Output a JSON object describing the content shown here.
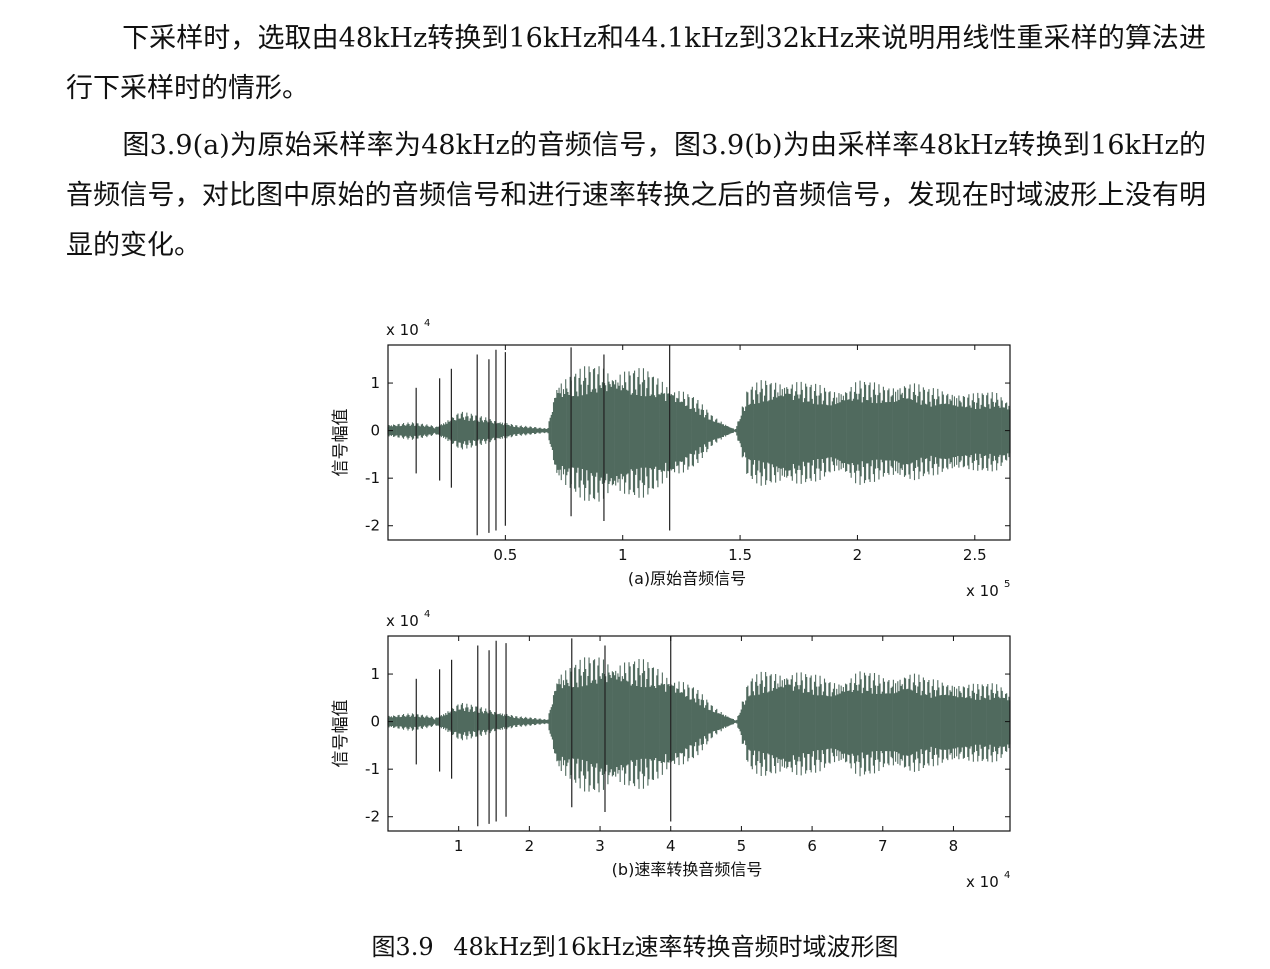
{
  "paragraphs": [
    "下采样时，选取由48kHz转换到16kHz和44.1kHz到32kHz来说明用线性重采样的算法进行下采样时的情形。",
    "图3.9(a)为原始采样率为48kHz的音频信号，图3.9(b)为由采样率48kHz转换到16kHz的音频信号，对比图中原始的音频信号和进行速率转换之后的音频信号，发现在时域波形上没有明显的变化。"
  ],
  "chart_data": [
    {
      "type": "line",
      "subtitle": "(a)原始音频信号",
      "ylabel": "信号幅值",
      "y_multiplier": "x 10",
      "y_exponent": "4",
      "x_multiplier": "x 10",
      "x_exponent": "5",
      "xlim": [
        0.0,
        2.65
      ],
      "ylim": [
        -2.3,
        1.8
      ],
      "xticks": [
        0.5,
        1,
        1.5,
        2,
        2.5
      ],
      "xtick_labels": [
        "0.5",
        "1",
        "1.5",
        "2",
        "2.5"
      ],
      "yticks": [
        1,
        0,
        -1,
        -2
      ],
      "ytick_labels": [
        "1",
        "0",
        "-1",
        "-2"
      ],
      "series_color": "#3d5a4c",
      "envelope": {
        "x": [
          0.0,
          0.1,
          0.19,
          0.2,
          0.31,
          0.32,
          0.5,
          0.55,
          0.68,
          0.72,
          0.8,
          0.9,
          1.0,
          1.1,
          1.2,
          1.3,
          1.38,
          1.45,
          1.48,
          1.53,
          1.6,
          1.7,
          1.8,
          1.9,
          2.0,
          2.1,
          2.2,
          2.3,
          2.4,
          2.5,
          2.6,
          2.65
        ],
        "upper": [
          0.15,
          0.18,
          0.12,
          0.08,
          0.45,
          0.4,
          0.2,
          0.12,
          0.05,
          1.2,
          1.3,
          1.45,
          1.4,
          1.3,
          1.1,
          0.75,
          0.35,
          0.12,
          0.03,
          0.9,
          1.1,
          1.2,
          1.0,
          0.95,
          1.1,
          1.0,
          1.15,
          0.9,
          0.95,
          0.8,
          0.85,
          0.7
        ],
        "lower": [
          -0.15,
          -0.2,
          -0.12,
          -0.08,
          -0.45,
          -0.4,
          -0.2,
          -0.12,
          -0.05,
          -1.25,
          -1.4,
          -1.6,
          -1.5,
          -1.4,
          -1.2,
          -0.8,
          -0.35,
          -0.12,
          -0.03,
          -1.0,
          -1.2,
          -1.3,
          -1.1,
          -1.0,
          -1.2,
          -1.05,
          -1.2,
          -0.95,
          -1.0,
          -0.85,
          -0.9,
          -0.75
        ]
      },
      "spikes": [
        {
          "x": 0.12,
          "top": 0.9,
          "bottom": -0.9
        },
        {
          "x": 0.22,
          "top": 1.1,
          "bottom": -1.05
        },
        {
          "x": 0.27,
          "top": 1.3,
          "bottom": -1.2
        },
        {
          "x": 0.38,
          "top": 1.6,
          "bottom": -2.2
        },
        {
          "x": 0.43,
          "top": 1.5,
          "bottom": -2.15
        },
        {
          "x": 0.46,
          "top": 1.7,
          "bottom": -2.1
        },
        {
          "x": 0.5,
          "top": 1.65,
          "bottom": -2.0
        },
        {
          "x": 0.78,
          "top": 1.75,
          "bottom": -1.8
        },
        {
          "x": 0.92,
          "top": 1.6,
          "bottom": -1.9
        },
        {
          "x": 1.2,
          "top": 1.8,
          "bottom": -2.1
        }
      ]
    },
    {
      "type": "line",
      "subtitle": "(b)速率转换音频信号",
      "ylabel": "信号幅值",
      "y_multiplier": "x 10",
      "y_exponent": "4",
      "x_multiplier": "x 10",
      "x_exponent": "4",
      "xlim": [
        0.0,
        8.8
      ],
      "ylim": [
        -2.3,
        1.8
      ],
      "xticks": [
        1,
        2,
        3,
        4,
        5,
        6,
        7,
        8
      ],
      "xtick_labels": [
        "1",
        "2",
        "3",
        "4",
        "5",
        "6",
        "7",
        "8"
      ],
      "yticks": [
        1,
        0,
        -1,
        -2
      ],
      "ytick_labels": [
        "1",
        "0",
        "-1",
        "-2"
      ],
      "series_color": "#3d5a4c",
      "envelope": {
        "x": [
          0.0,
          0.33,
          0.63,
          0.66,
          1.03,
          1.06,
          1.66,
          1.83,
          2.26,
          2.4,
          2.66,
          3.0,
          3.33,
          3.66,
          4.0,
          4.33,
          4.6,
          4.83,
          4.93,
          5.1,
          5.33,
          5.66,
          6.0,
          6.33,
          6.66,
          7.0,
          7.33,
          7.66,
          8.0,
          8.33,
          8.66,
          8.8
        ],
        "upper": [
          0.15,
          0.18,
          0.12,
          0.08,
          0.45,
          0.4,
          0.2,
          0.12,
          0.05,
          1.2,
          1.3,
          1.45,
          1.4,
          1.3,
          1.1,
          0.75,
          0.35,
          0.12,
          0.03,
          0.9,
          1.1,
          1.2,
          1.0,
          0.95,
          1.1,
          1.0,
          1.15,
          0.9,
          0.95,
          0.8,
          0.85,
          0.7
        ],
        "lower": [
          -0.15,
          -0.2,
          -0.12,
          -0.08,
          -0.45,
          -0.4,
          -0.2,
          -0.12,
          -0.05,
          -1.25,
          -1.4,
          -1.6,
          -1.5,
          -1.4,
          -1.2,
          -0.8,
          -0.35,
          -0.12,
          -0.03,
          -1.0,
          -1.2,
          -1.3,
          -1.1,
          -1.0,
          -1.2,
          -1.05,
          -1.2,
          -0.95,
          -1.0,
          -0.85,
          -0.9,
          -0.75
        ]
      },
      "spikes": [
        {
          "x": 0.4,
          "top": 0.9,
          "bottom": -0.9
        },
        {
          "x": 0.73,
          "top": 1.1,
          "bottom": -1.05
        },
        {
          "x": 0.9,
          "top": 1.3,
          "bottom": -1.2
        },
        {
          "x": 1.27,
          "top": 1.6,
          "bottom": -2.2
        },
        {
          "x": 1.43,
          "top": 1.5,
          "bottom": -2.15
        },
        {
          "x": 1.53,
          "top": 1.7,
          "bottom": -2.1
        },
        {
          "x": 1.67,
          "top": 1.65,
          "bottom": -2.0
        },
        {
          "x": 2.6,
          "top": 1.75,
          "bottom": -1.8
        },
        {
          "x": 3.07,
          "top": 1.6,
          "bottom": -1.9
        },
        {
          "x": 4.0,
          "top": 1.8,
          "bottom": -2.1
        }
      ]
    }
  ],
  "caption": {
    "number": "图3.9",
    "text": "48kHz到16kHz速率转换音频时域波形图"
  }
}
